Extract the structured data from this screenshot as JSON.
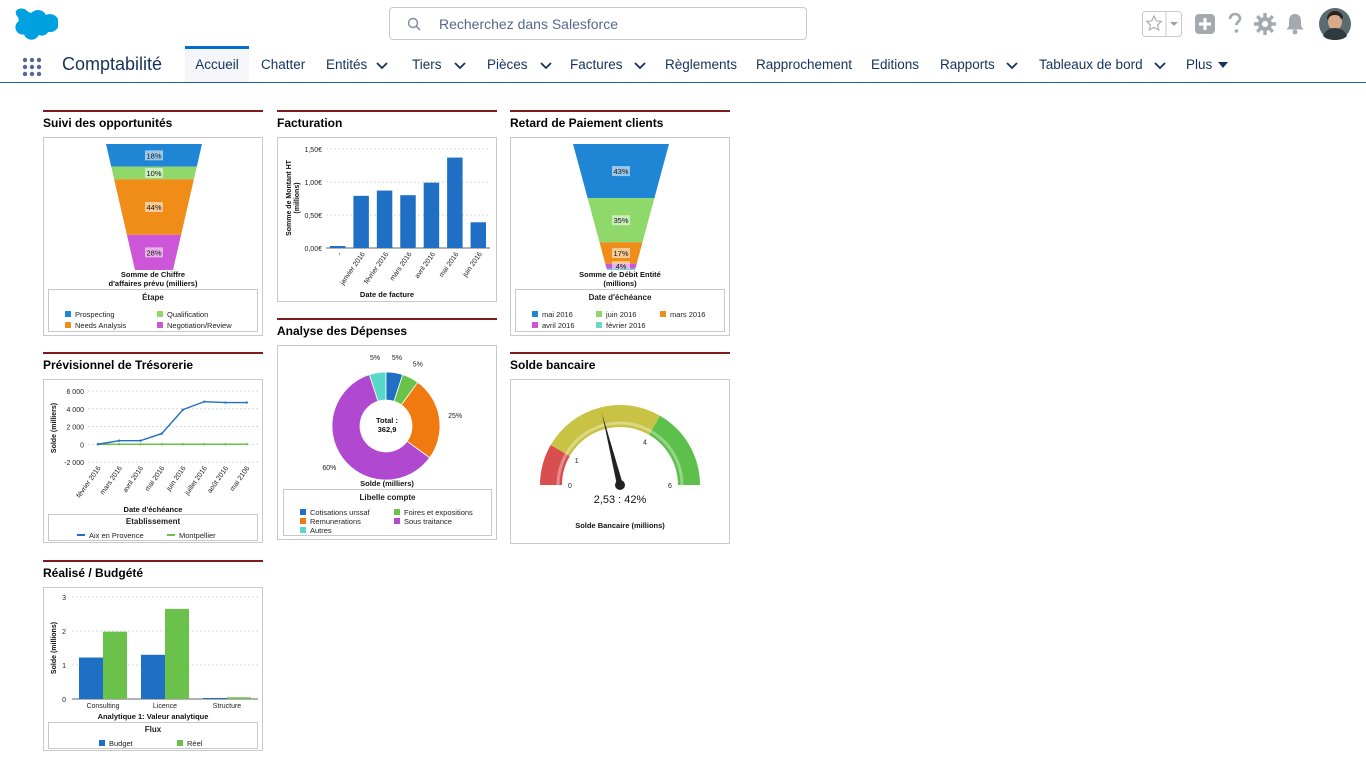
{
  "header": {
    "search_placeholder": "Recherchez dans Salesforce"
  },
  "nav": {
    "app_name": "Comptabilité",
    "tabs": [
      "Accueil",
      "Chatter",
      "Entités",
      "Tiers",
      "Pièces",
      "Factures",
      "Règlements",
      "Rapprochement",
      "Editions",
      "Rapports",
      "Tableaux de bord",
      "Plus"
    ]
  },
  "widgets": {
    "opportunites": {
      "title": "Suivi des opportunités",
      "caption": [
        "Somme de Chiffre",
        "d'affaires prévu (milliers)"
      ],
      "legend_title": "Étape",
      "legend": [
        "Prospecting",
        "Qualification",
        "Needs Analysis",
        "Negotiation/Review"
      ],
      "colors": [
        "#1f86d6",
        "#8fd86a",
        "#f08c18",
        "#cc55d8"
      ]
    },
    "facturation": {
      "title": "Facturation",
      "ylabel": [
        "Somme de Montant HT",
        "(millions)"
      ],
      "xlabel": "Date de facture"
    },
    "retard": {
      "title": "Retard de Paiement clients",
      "caption": [
        "Somme de Débit Entité",
        "(millions)"
      ],
      "legend_title": "Date d'échéance",
      "legend": [
        "mai 2016",
        "juin 2016",
        "mars 2016",
        "avril 2016",
        "février 2016"
      ],
      "colors": [
        "#1f86d6",
        "#8fd86a",
        "#f08c18",
        "#cc55d8",
        "#6ed8c8"
      ]
    },
    "depenses": {
      "title": "Analyse des Dépenses",
      "total_label": "Total :",
      "total_value": "362,9",
      "caption": "Solde (milliers)",
      "legend_title": "Libelle compte",
      "legend": [
        "Cotisations urssaf",
        "Foires et expositions",
        "Remunerations",
        "Sous traitance",
        "Autres"
      ],
      "colors": [
        "#1f6fc4",
        "#6ac24a",
        "#f07a10",
        "#b048d0",
        "#58d8c8"
      ]
    },
    "tresorerie": {
      "title": "Prévisionnel de Trésorerie",
      "ylabel": "Solde (milliers)",
      "xlabel": "Date d'échéance",
      "legend_title": "Etablissement",
      "legend": [
        "Aix en Provence",
        "Montpellier"
      ]
    },
    "solde": {
      "title": "Solde bancaire",
      "readout": "2,53 : 42%",
      "caption": "Solde Bancaire (millions)"
    },
    "budget": {
      "title": "Réalisé / Budgété",
      "ylabel": "Solde (millions)",
      "xlabel": "Analytique 1: Valeur analytique",
      "legend_title": "Flux",
      "legend": [
        "Budget",
        "Réel"
      ]
    }
  },
  "chart_data": [
    {
      "type": "funnel",
      "id": "opportunites",
      "categories": [
        "Prospecting",
        "Qualification",
        "Needs Analysis",
        "Negotiation/Review"
      ],
      "values": [
        18,
        10,
        44,
        28
      ],
      "labels": [
        "18%",
        "10%",
        "44%",
        "28%"
      ]
    },
    {
      "type": "bar",
      "id": "facturation",
      "categories": [
        "-",
        "janvier 2016",
        "février 2016",
        "mars 2016",
        "avril 2016",
        "mai 2016",
        "juin 2016"
      ],
      "values": [
        0.03,
        0.79,
        0.87,
        0.8,
        0.99,
        1.37,
        0.39
      ],
      "ylim": [
        0,
        1.5
      ],
      "yticks": [
        "0,00€",
        "0,50€",
        "1,00€",
        "1,50€"
      ]
    },
    {
      "type": "funnel",
      "id": "retard",
      "categories": [
        "mai 2016",
        "juin 2016",
        "mars 2016",
        "avril 2016",
        "février 2016"
      ],
      "values": [
        43,
        35,
        17,
        4,
        1
      ],
      "labels": [
        "43%",
        "35%",
        "17%",
        "4%",
        ""
      ]
    },
    {
      "type": "pie",
      "id": "depenses",
      "categories": [
        "Cotisations urssaf",
        "Foires et expositions",
        "Remunerations",
        "Sous traitance",
        "Autres"
      ],
      "values": [
        5,
        5,
        25,
        60,
        5
      ],
      "labels": [
        "5%",
        "5%",
        "25%",
        "60%",
        "5%"
      ]
    },
    {
      "type": "line",
      "id": "tresorerie",
      "x": [
        "février 2016",
        "mars 2016",
        "avril 2016",
        "mai 2016",
        "juin 2016",
        "juillet 2016",
        "août 2016",
        "mai 2106"
      ],
      "series": [
        {
          "name": "Aix en Provence",
          "values": [
            0,
            400,
            400,
            1200,
            3900,
            4800,
            4700,
            4700
          ]
        },
        {
          "name": "Montpellier",
          "values": [
            0,
            0,
            0,
            0,
            0,
            0,
            0,
            0
          ]
        }
      ],
      "ylim": [
        -2000,
        6000
      ],
      "yticks": [
        "-2 000",
        "0",
        "2 000",
        "4 000",
        "6 000"
      ]
    },
    {
      "type": "gauge",
      "id": "solde",
      "value": 2.53,
      "min": 0,
      "max": 6,
      "ticks": [
        "0",
        "1",
        "4",
        "6"
      ]
    },
    {
      "type": "bar",
      "id": "budget",
      "categories": [
        "Consulting",
        "Licence",
        "Structure"
      ],
      "series": [
        {
          "name": "Budget",
          "values": [
            1.22,
            1.3,
            0.03
          ]
        },
        {
          "name": "Réel",
          "values": [
            1.98,
            2.65,
            0.05
          ]
        }
      ],
      "ylim": [
        0,
        3
      ],
      "yticks": [
        "0",
        "1",
        "2",
        "3"
      ]
    }
  ]
}
